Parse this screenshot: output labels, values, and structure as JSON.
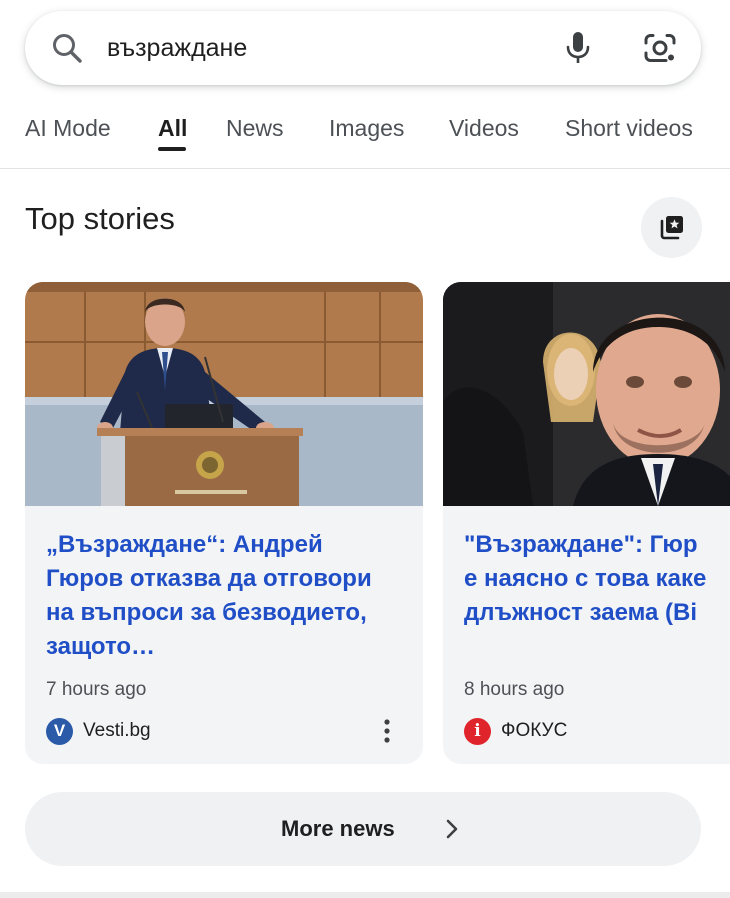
{
  "search": {
    "query": "възраждане",
    "icons": [
      "search-icon",
      "microphone-icon",
      "google-lens-icon"
    ]
  },
  "tabs": [
    {
      "label": "AI Mode",
      "active": false
    },
    {
      "label": "All",
      "active": true
    },
    {
      "label": "News",
      "active": false
    },
    {
      "label": "Images",
      "active": false
    },
    {
      "label": "Videos",
      "active": false
    },
    {
      "label": "Short videos",
      "active": false
    }
  ],
  "top_stories": {
    "title": "Top stories",
    "stack_icon": "stories-stack-icon",
    "cards": [
      {
        "headline": "„Възраждане“: Андрей Гюров отказва да отговори на въпроси за безводието, защото…",
        "time": "7 hours ago",
        "source": "Vesti.bg",
        "source_logo_letter": "V",
        "source_logo_color": "#2a5aa8",
        "image_alt": "man-at-podium-photo"
      },
      {
        "headline": "\"Възраждане\": Гюр\nе наясно с това каке\nдлъжност заема (Ві",
        "time": "8 hours ago",
        "source": "ФОКУС",
        "source_logo_letter": "i",
        "source_logo_color": "#e0242b",
        "image_alt": "man-in-crowd-photo"
      }
    ]
  },
  "more_news": {
    "label": "More news"
  },
  "colors": {
    "link_blue": "#1f4ec6",
    "text": "#1f1f1f",
    "muted": "#4d5156",
    "card_bg": "#f3f4f6"
  }
}
